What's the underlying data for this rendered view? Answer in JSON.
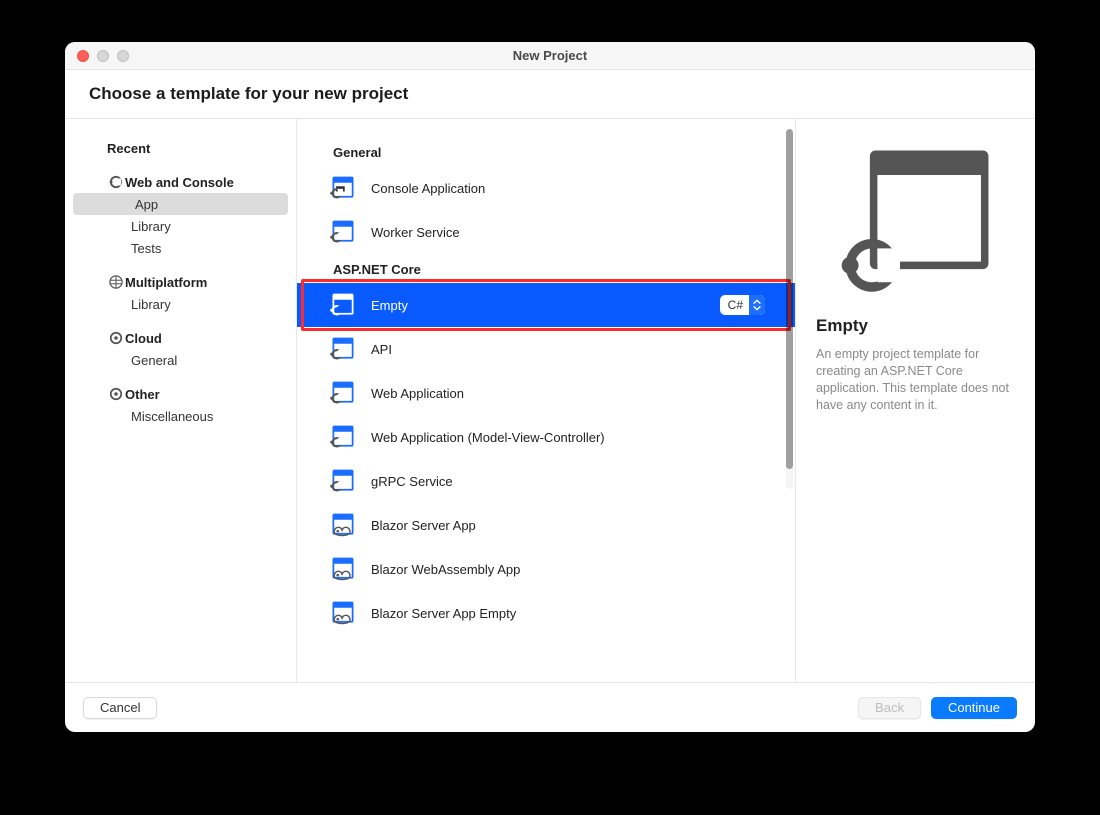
{
  "window_title": "New Project",
  "subtitle": "Choose a template for your new project",
  "sidebar": [
    {
      "type": "header",
      "icon": "none",
      "label": "Recent",
      "name": "sidebar-header-recent"
    },
    {
      "type": "header",
      "icon": "dotnet",
      "label": "Web and Console",
      "name": "sidebar-header-web-console"
    },
    {
      "type": "sub",
      "label": "App",
      "name": "sidebar-item-app",
      "selected": true
    },
    {
      "type": "sub",
      "label": "Library",
      "name": "sidebar-item-library",
      "selected": false
    },
    {
      "type": "sub",
      "label": "Tests",
      "name": "sidebar-item-tests",
      "selected": false
    },
    {
      "type": "header",
      "icon": "multi",
      "label": "Multiplatform",
      "name": "sidebar-header-multiplatform"
    },
    {
      "type": "sub",
      "label": "Library",
      "name": "sidebar-item-mp-library",
      "selected": false
    },
    {
      "type": "header",
      "icon": "cloud",
      "label": "Cloud",
      "name": "sidebar-header-cloud"
    },
    {
      "type": "sub",
      "label": "General",
      "name": "sidebar-item-cloud-general",
      "selected": false
    },
    {
      "type": "header",
      "icon": "other",
      "label": "Other",
      "name": "sidebar-header-other"
    },
    {
      "type": "sub",
      "label": "Miscellaneous",
      "name": "sidebar-item-miscellaneous",
      "selected": false
    }
  ],
  "sections": [
    {
      "title": "General",
      "templates": [
        {
          "label": "Console Application",
          "icon": "console",
          "name": "template-console-app",
          "selected": false
        },
        {
          "label": "Worker Service",
          "icon": "worker",
          "name": "template-worker-service",
          "selected": false
        }
      ]
    },
    {
      "title": "ASP.NET Core",
      "templates": [
        {
          "label": "Empty",
          "icon": "empty",
          "name": "template-empty",
          "selected": true,
          "highlight": true,
          "language": "C#"
        },
        {
          "label": "API",
          "icon": "empty",
          "name": "template-api",
          "selected": false
        },
        {
          "label": "Web Application",
          "icon": "empty",
          "name": "template-web-app",
          "selected": false
        },
        {
          "label": "Web Application (Model-View-Controller)",
          "icon": "empty",
          "name": "template-web-app-mvc",
          "selected": false
        },
        {
          "label": "gRPC Service",
          "icon": "empty",
          "name": "template-grpc",
          "selected": false
        },
        {
          "label": "Blazor Server App",
          "icon": "blazor",
          "name": "template-blazor-server",
          "selected": false
        },
        {
          "label": "Blazor WebAssembly App",
          "icon": "blazor",
          "name": "template-blazor-wasm",
          "selected": false
        },
        {
          "label": "Blazor Server App Empty",
          "icon": "blazor",
          "name": "template-blazor-server-empty",
          "selected": false
        }
      ]
    }
  ],
  "detail": {
    "title": "Empty",
    "description": "An empty project template for creating an ASP.NET Core application. This template does not have any content in it."
  },
  "footer": {
    "cancel": "Cancel",
    "back": "Back",
    "continue": "Continue"
  }
}
